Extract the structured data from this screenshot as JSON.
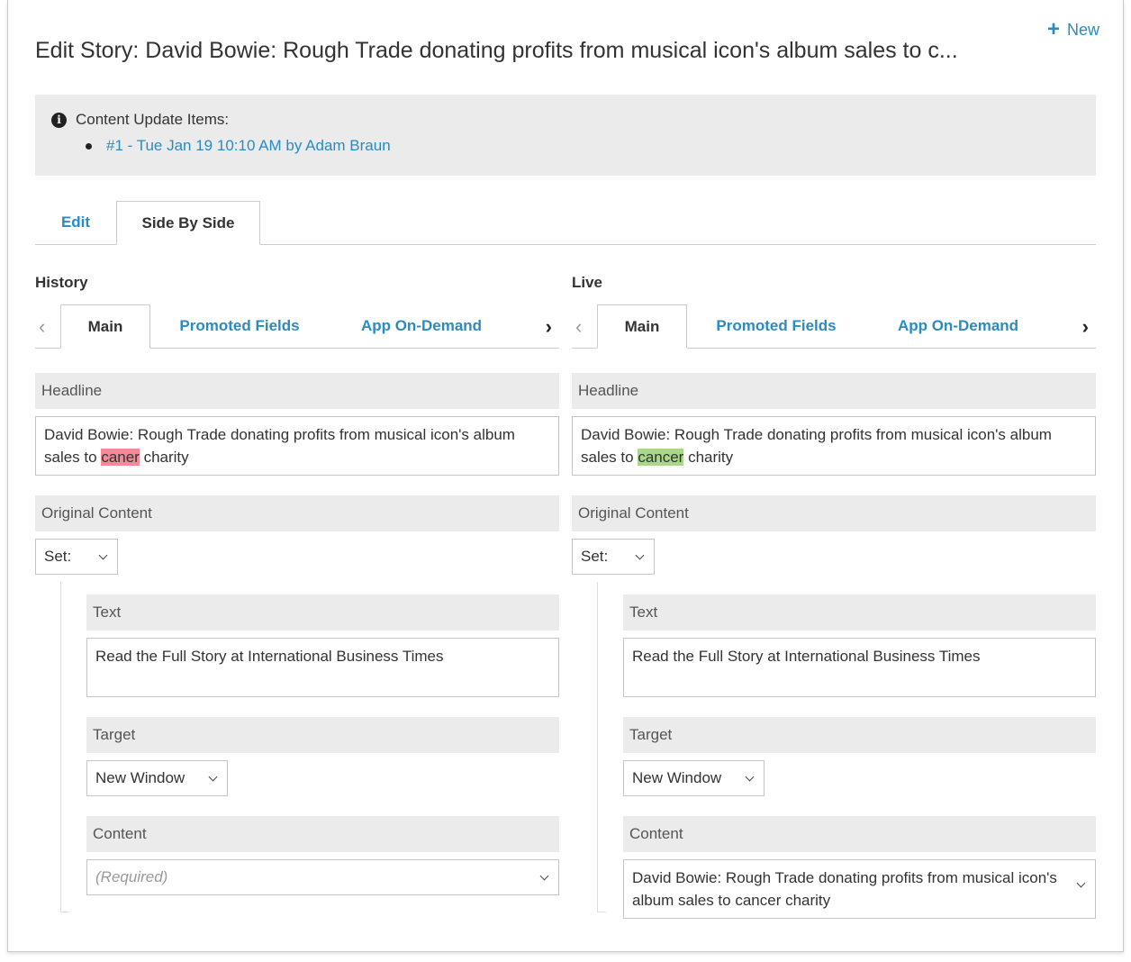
{
  "header": {
    "new_label": "New",
    "title": "Edit Story: David Bowie: Rough Trade donating profits from musical icon's album sales to c..."
  },
  "updates": {
    "heading": "Content Update Items:",
    "items": [
      "#1 - Tue Jan 19 10:10 AM by Adam Braun"
    ]
  },
  "main_tabs": {
    "edit": "Edit",
    "side_by_side": "Side By Side"
  },
  "history": {
    "title": "History",
    "tabs": {
      "main": "Main",
      "promoted": "Promoted Fields",
      "app": "App On-Demand"
    },
    "headline_label": "Headline",
    "headline_pre": "David Bowie: Rough Trade donating profits from musical icon's album sales to ",
    "headline_diff": "caner",
    "headline_post": " charity",
    "original_content_label": "Original Content",
    "set_label": "Set:",
    "text_label": "Text",
    "text_value": "Read the Full Story at International Business Times",
    "target_label": "Target",
    "target_value": "New Window",
    "content_label": "Content",
    "content_placeholder": "(Required)"
  },
  "live": {
    "title": "Live",
    "tabs": {
      "main": "Main",
      "promoted": "Promoted Fields",
      "app": "App On-Demand"
    },
    "headline_label": "Headline",
    "headline_pre": "David Bowie: Rough Trade donating profits from musical icon's album sales to ",
    "headline_diff": "cancer",
    "headline_post": " charity",
    "original_content_label": "Original Content",
    "set_label": "Set:",
    "text_label": "Text",
    "text_value": "Read the Full Story at International Business Times",
    "target_label": "Target",
    "target_value": "New Window",
    "content_label": "Content",
    "content_value": "David Bowie: Rough Trade donating profits from musical icon's album sales to cancer charity"
  },
  "colors": {
    "link": "#2a8bc3",
    "diff_removed": "#f28a97",
    "diff_added": "#a9d887",
    "label_bg": "#ebebeb"
  },
  "icons": [
    "plus-icon",
    "info-icon",
    "chevron-left-icon",
    "chevron-right-icon",
    "chevron-down-icon"
  ]
}
